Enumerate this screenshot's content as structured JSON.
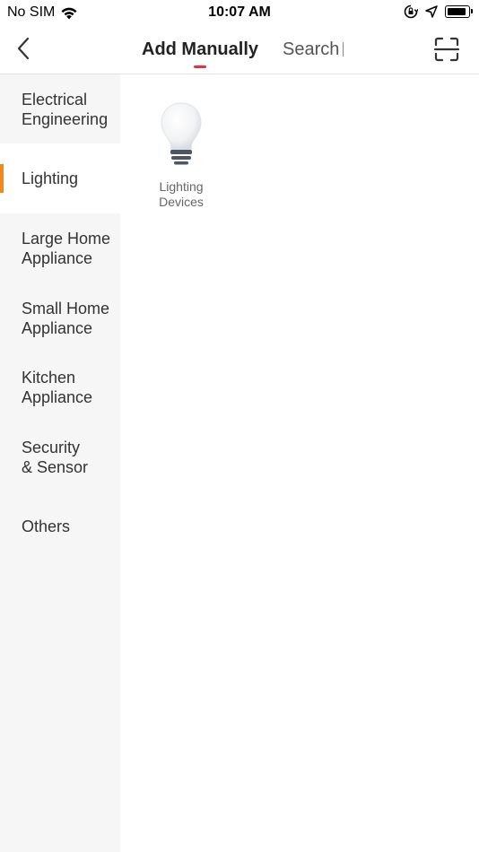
{
  "status_bar": {
    "carrier": "No SIM",
    "time": "10:07 AM"
  },
  "nav": {
    "tabs": [
      {
        "label": "Add Manually",
        "active": true
      },
      {
        "label": "Search",
        "active": false
      }
    ],
    "indicator_color": "#e3343e"
  },
  "sidebar": {
    "accent_color": "#f08a1c",
    "items": [
      {
        "label": "Electrical\nEngineering",
        "active": false
      },
      {
        "label": "Lighting",
        "active": true
      },
      {
        "label": "Large Home\nAppliance",
        "active": false
      },
      {
        "label": "Small Home\nAppliance",
        "active": false
      },
      {
        "label": "Kitchen\nAppliance",
        "active": false
      },
      {
        "label": "Security\n& Sensor",
        "active": false
      },
      {
        "label": "Others",
        "active": false
      }
    ]
  },
  "content": {
    "devices": [
      {
        "label": "Lighting\nDevices",
        "icon": "light-bulb-icon"
      }
    ]
  }
}
